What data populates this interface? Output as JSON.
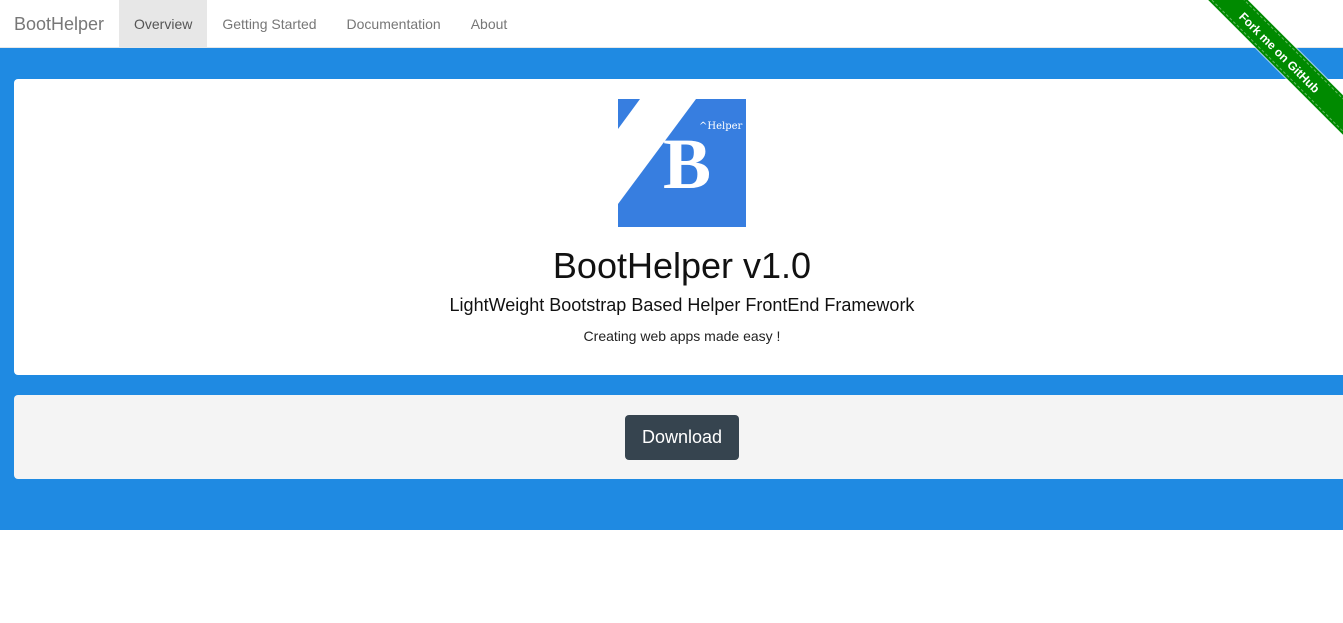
{
  "navbar": {
    "brand": "BootHelper",
    "items": [
      {
        "label": "Overview",
        "active": true
      },
      {
        "label": "Getting Started",
        "active": false
      },
      {
        "label": "Documentation",
        "active": false
      },
      {
        "label": "About",
        "active": false
      }
    ]
  },
  "ribbon": {
    "label": "Fork me on GitHub",
    "color": "#008a00"
  },
  "hero": {
    "background": "#1f8ae2",
    "logo": {
      "letter": "B",
      "superscript": "^Helper",
      "color": "#377ee0"
    },
    "title": "BootHelper v1.0",
    "subtitle": "LightWeight Bootstrap Based Helper FrontEnd Framework",
    "tagline": "Creating web apps made easy !"
  },
  "actions": {
    "download_label": "Download",
    "download_color": "#36444f"
  }
}
